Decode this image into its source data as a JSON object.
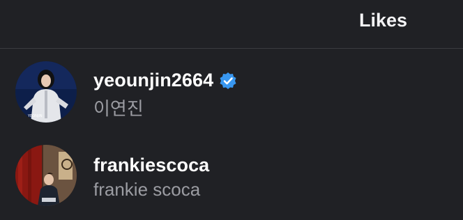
{
  "header": {
    "title": "Likes"
  },
  "likes": [
    {
      "username": "yeounjin2664",
      "full_name": "이연진",
      "verified": true,
      "avatar_icon": "profile-photo-woman-skater"
    },
    {
      "username": "frankiescoca",
      "full_name": "frankie scoca",
      "verified": false,
      "avatar_icon": "profile-photo-man-red-wall"
    }
  ],
  "colors": {
    "background": "#202125",
    "secondary_text": "#9b9ca2",
    "verified_badge": "#3897f0",
    "divider": "#3a3b40"
  }
}
